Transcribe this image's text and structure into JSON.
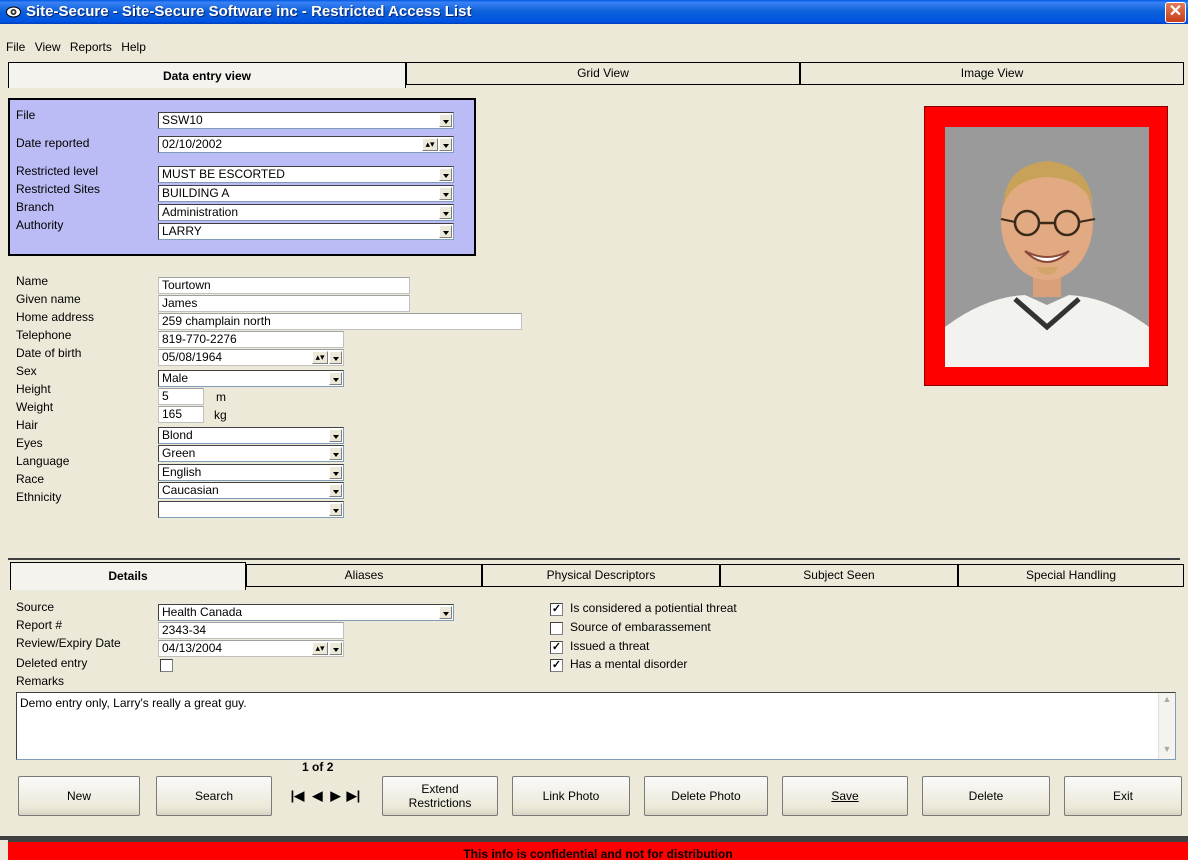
{
  "window": {
    "title": "Site-Secure - Site-Secure Software inc - Restricted Access List"
  },
  "menu": [
    "File",
    "View",
    "Reports",
    "Help"
  ],
  "top_tabs": [
    "Data entry view",
    "Grid View",
    "Image View"
  ],
  "record_header": {
    "file_label": "File",
    "file_value": "SSW10",
    "date_label": "Date reported",
    "date_value": "02/10/2002",
    "restricted_level_label": "Restricted level",
    "restricted_level_value": "MUST BE ESCORTED",
    "restricted_sites_label": "Restricted Sites",
    "restricted_sites_value": "BUILDING A",
    "branch_label": "Branch",
    "branch_value": "Administration",
    "authority_label": "Authority",
    "authority_value": "LARRY"
  },
  "person": {
    "name_label": "Name",
    "name_value": "Tourtown",
    "given_label": "Given name",
    "given_value": "James",
    "address_label": "Home address",
    "address_value": "259 champlain north",
    "phone_label": "Telephone",
    "phone_value": "819-770-2276",
    "dob_label": "Date of birth",
    "dob_value": "05/08/1964",
    "sex_label": "Sex",
    "sex_value": "Male",
    "height_label": "Height",
    "height_value": "5",
    "height_unit": "m",
    "weight_label": "Weight",
    "weight_value": "165",
    "weight_unit": "kg",
    "hair_label": "Hair",
    "hair_value": "Blond",
    "eyes_label": "Eyes",
    "eyes_value": "Green",
    "language_label": "Language",
    "language_value": "English",
    "race_label": "Race",
    "race_value": "Caucasian",
    "ethnicity_label": "Ethnicity",
    "ethnicity_value": ""
  },
  "bottom_tabs": [
    "Details",
    "Aliases",
    "Physical Descriptors",
    "Subject Seen",
    "Special Handling"
  ],
  "details": {
    "source_label": "Source",
    "source_value": "Health Canada",
    "report_label": "Report #",
    "report_value": "2343-34",
    "review_label": "Review/Expiry Date",
    "review_value": "04/13/2004",
    "deleted_label": "Deleted entry",
    "remarks_label": "Remarks",
    "remarks_value": "Demo entry only, Larry's really a great guy."
  },
  "flags": [
    {
      "label": "Is considered a potiential threat",
      "checked": true
    },
    {
      "label": "Source of embarassement",
      "checked": false
    },
    {
      "label": "Issued a threat",
      "checked": true
    },
    {
      "label": "Has a mental disorder",
      "checked": true
    }
  ],
  "record_nav": {
    "current": "1",
    "of": "of",
    "total": "2"
  },
  "buttons": {
    "new": "New",
    "search": "Search",
    "extend1": "Extend",
    "extend2": "Restrictions",
    "link_photo": "Link Photo",
    "delete_photo": "Delete Photo",
    "save": "Save",
    "delete": "Delete",
    "exit": "Exit"
  },
  "footer_text": "This info is confidential and not for distribution",
  "colors": {
    "header_panel": "#bbbbf5",
    "photo_frame": "#ff0000",
    "footer": "#ff0000",
    "titlebar": "#0054e3"
  }
}
